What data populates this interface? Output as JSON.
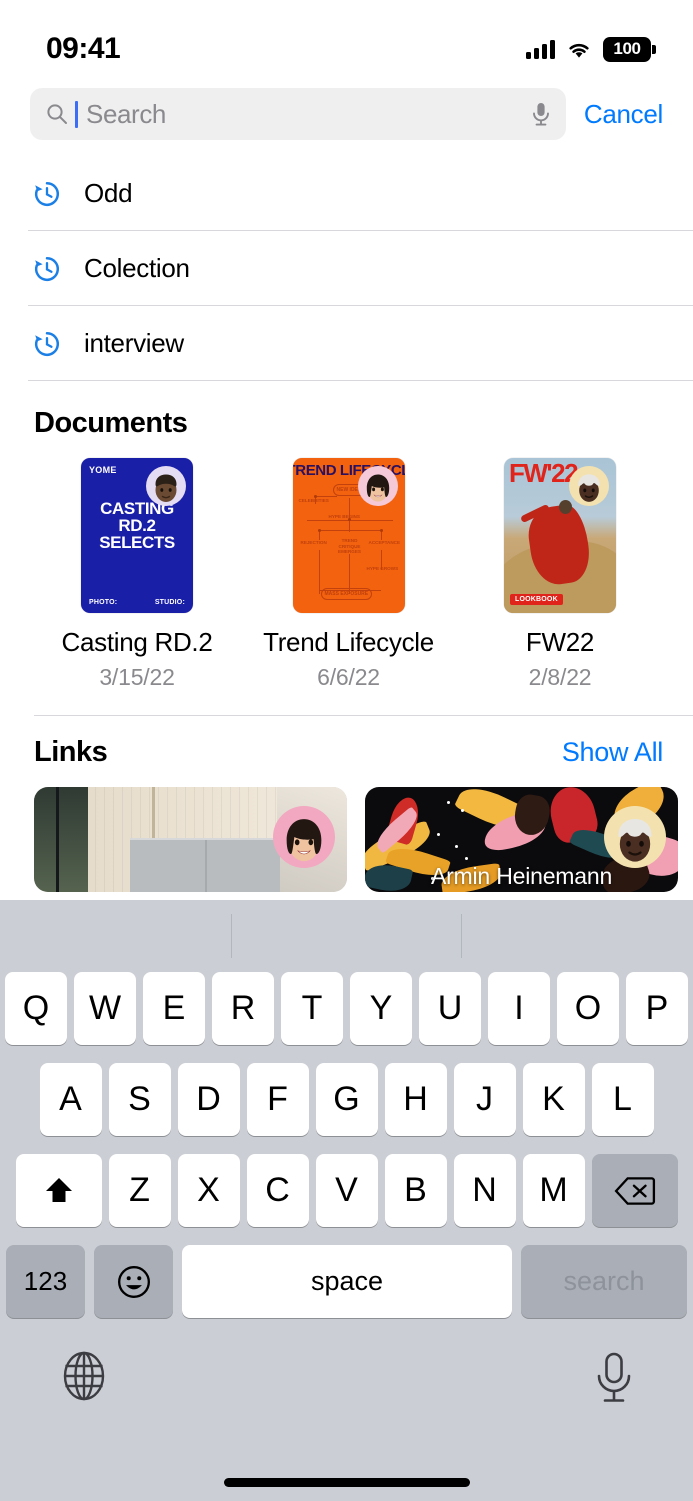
{
  "status_bar": {
    "time": "09:41",
    "battery_level": "100",
    "icons": {
      "cellular": "signal-bars-icon",
      "wifi": "wifi-icon",
      "battery": "battery-icon"
    }
  },
  "search": {
    "placeholder": "Search",
    "value": "",
    "cancel_label": "Cancel",
    "accent_color": "#007AFF",
    "caret_color": "#3C6EF5",
    "field_background": "#EFEFF0"
  },
  "recent_searches": {
    "items": [
      {
        "label": "Odd"
      },
      {
        "label": "Colection"
      },
      {
        "label": "interview"
      }
    ]
  },
  "documents": {
    "title": "Documents",
    "items": [
      {
        "title": "Casting RD.2",
        "date": "3/15/22",
        "thumb": {
          "background": "#1A1FA8",
          "brand": "YOME",
          "headline_1": "CASTING",
          "headline_2": "RD.2",
          "headline_3": "SELECTS",
          "footer_left": "PHOTO:",
          "footer_right": "STUDIO:"
        },
        "avatar_background": "#E4DCF3"
      },
      {
        "title": "Trend Lifecycle",
        "date": "6/6/22",
        "thumb": {
          "background": "#F2620F",
          "headline": "TREND LIFECYCLE",
          "nodes": [
            "NEW IDEA",
            "CELEBRITIES",
            "HYPE BEGINS",
            "REJECTION",
            "TREND CRITIQUE EMERGES",
            "ACCEPTANCE",
            "HYPE GROWS",
            "MASS EXPOSURE"
          ]
        },
        "avatar_background": "#F6C9D8"
      },
      {
        "title": "FW22",
        "date": "2/8/22",
        "thumb": {
          "background": "#B8CBD8",
          "headline": "FW'22",
          "tag": "LOOKBOOK",
          "accent": "#E0241B"
        },
        "avatar_background": "#F3E2B0"
      }
    ]
  },
  "links": {
    "title": "Links",
    "show_all_label": "Show All",
    "items": [
      {
        "caption": "",
        "kind": "interior-photo",
        "avatar_background": "#F2A8C0"
      },
      {
        "caption": "Armin Heinemann",
        "kind": "floral-artwork",
        "avatar_background": "#F3E2B0"
      }
    ]
  },
  "keyboard": {
    "row1": [
      "Q",
      "W",
      "E",
      "R",
      "T",
      "Y",
      "U",
      "I",
      "O",
      "P"
    ],
    "row2": [
      "A",
      "S",
      "D",
      "F",
      "G",
      "H",
      "J",
      "K",
      "L"
    ],
    "row3": [
      "Z",
      "X",
      "C",
      "V",
      "B",
      "N",
      "M"
    ],
    "shift_icon": "shift-icon",
    "backspace_icon": "backspace-icon",
    "numbers_label": "123",
    "emoji_icon": "emoji-icon",
    "space_label": "space",
    "return_label": "search",
    "globe_icon": "globe-icon",
    "dictation_icon": "microphone-icon",
    "key_background": "#FFFFFF",
    "modifier_background": "#A9AEB7",
    "keyboard_background": "#CBCED4"
  }
}
